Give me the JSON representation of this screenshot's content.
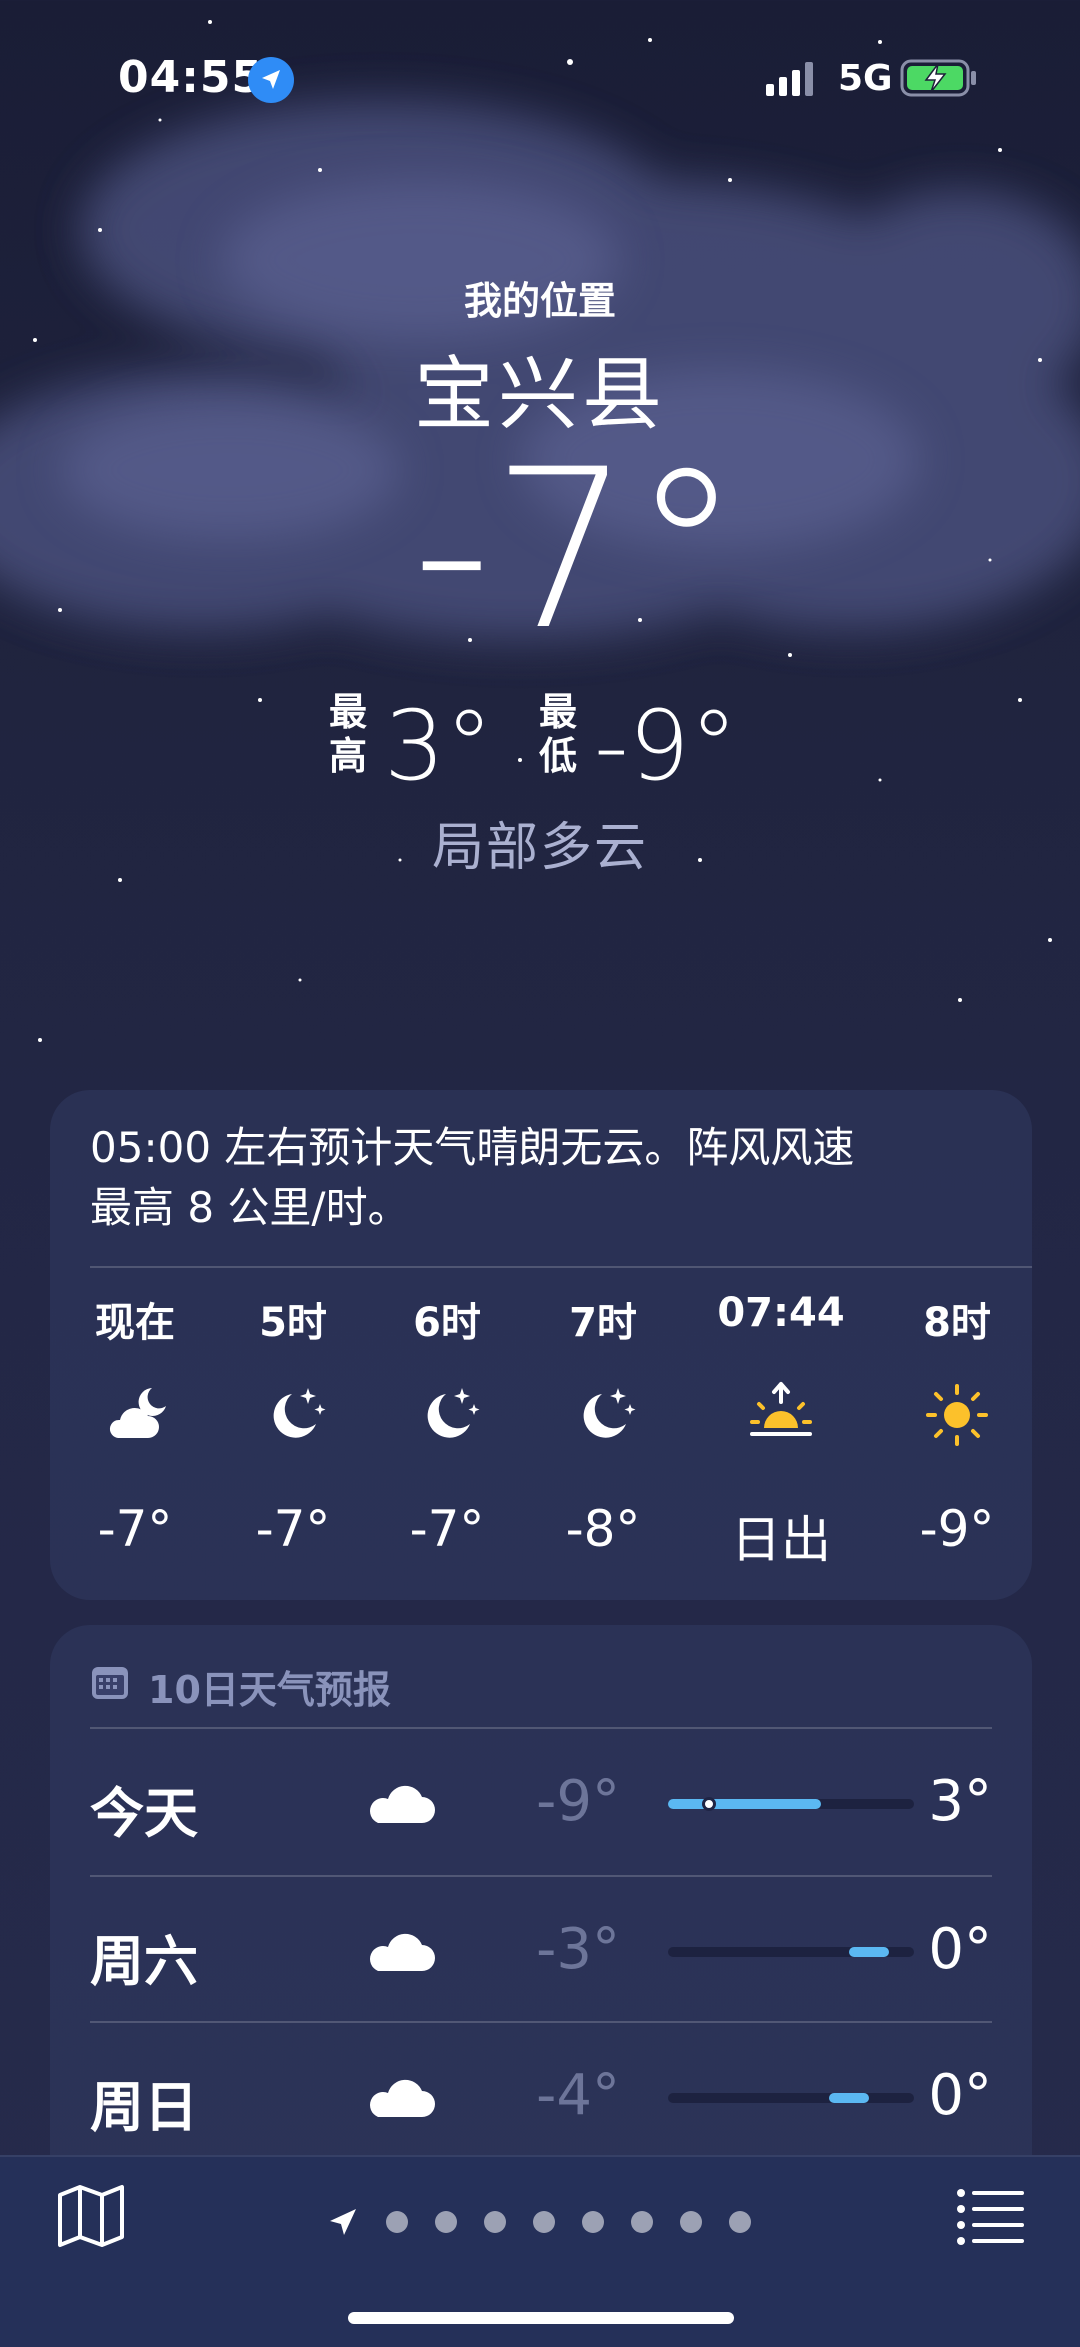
{
  "status_bar": {
    "time": "04:55",
    "network": "5G",
    "icons": [
      "location-arrow-icon",
      "signal-icon",
      "battery-charging-icon"
    ]
  },
  "header": {
    "location_label": "我的位置",
    "city": "宝兴县",
    "temperature": "-7°",
    "high_label_1": "最",
    "high_label_2": "高",
    "high": "3°",
    "low_label_1": "最",
    "low_label_2": "低",
    "low": "-9°",
    "condition": "局部多云"
  },
  "hourly": {
    "summary_line1": "05:00 左右预计天气晴朗无云。阵风风速",
    "summary_line2": "最高 8 公里/时。",
    "hours": [
      {
        "label": "现在",
        "icon": "cloud-moon-icon",
        "temp": "-7°"
      },
      {
        "label": "5时",
        "icon": "moon-stars-icon",
        "temp": "-7°"
      },
      {
        "label": "6时",
        "icon": "moon-stars-icon",
        "temp": "-7°"
      },
      {
        "label": "7时",
        "icon": "moon-stars-icon",
        "temp": "-8°"
      },
      {
        "label": "07:44",
        "icon": "sunrise-icon",
        "temp": "日出"
      },
      {
        "label": "8时",
        "icon": "sun-icon",
        "temp": "-9°"
      }
    ]
  },
  "ten_day": {
    "title": "10日天气预报",
    "icon": "calendar-icon",
    "days": [
      {
        "name": "今天",
        "icon": "cloud-icon",
        "low": "-9°",
        "high": "3°",
        "current": -7
      },
      {
        "name": "周六",
        "icon": "cloud-icon",
        "low": "-3°",
        "high": "0°"
      },
      {
        "name": "周日",
        "icon": "cloud-icon",
        "low": "-4°",
        "high": "0°"
      }
    ],
    "range_min": -9,
    "range_max": 3
  },
  "bottom_bar": {
    "icons": [
      "map-icon",
      "location-arrow-icon",
      "list-icon"
    ],
    "page_count": 8,
    "active_page": 0
  },
  "colors": {
    "background": "#20243f",
    "accent_blue": "#2f8cf6",
    "bar_fill": "#5bb8f2",
    "sun_yellow": "#fcc12b",
    "battery_green": "#4cd964"
  }
}
